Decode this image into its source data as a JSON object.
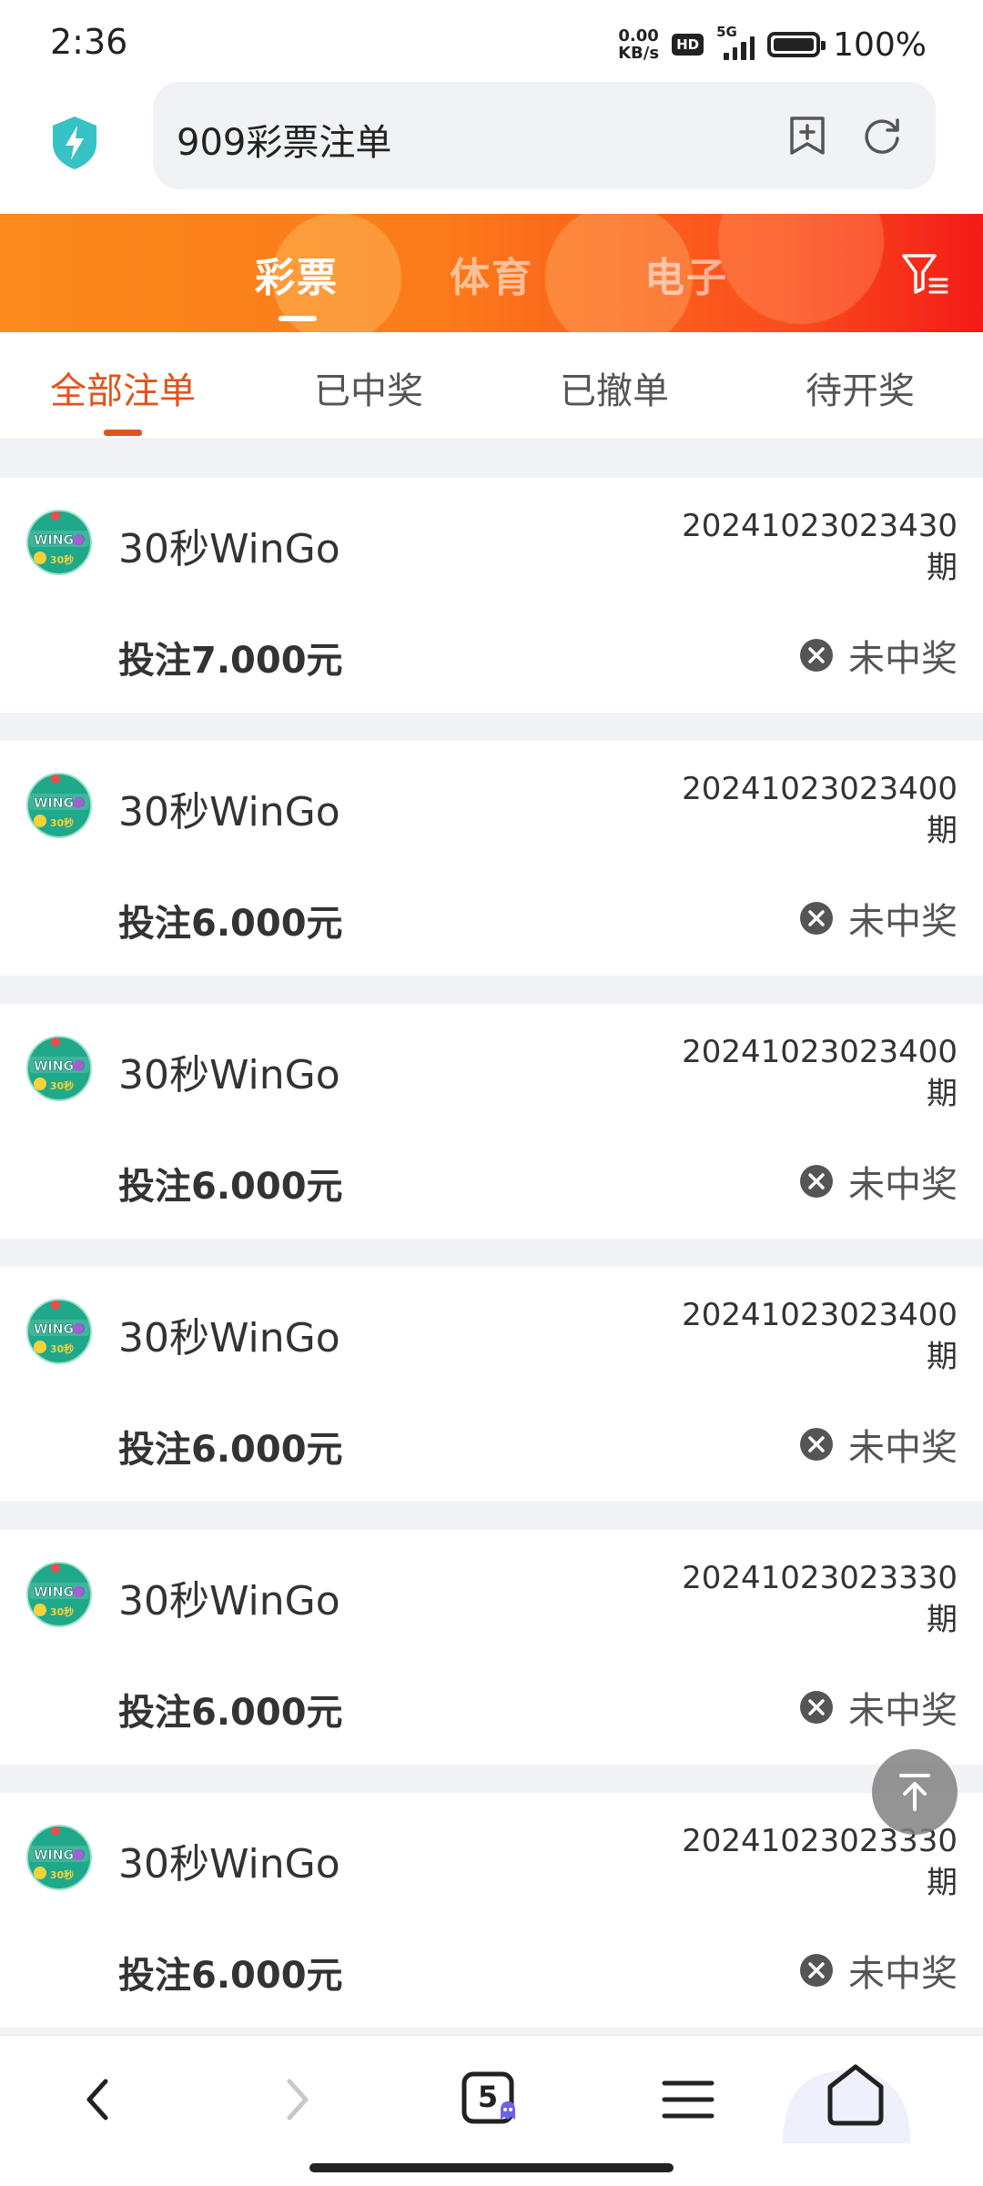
{
  "status_bar": {
    "time": "2:36",
    "net_speed_value": "0.00",
    "net_speed_unit": "KB/s",
    "hd": "HD",
    "network": "5G",
    "battery": "100%"
  },
  "address_bar": {
    "url_text": "909彩票注单"
  },
  "category_tabs": [
    {
      "label": "彩票",
      "active": true
    },
    {
      "label": "体育",
      "active": false
    },
    {
      "label": "电子",
      "active": false
    }
  ],
  "sub_tabs": [
    {
      "label": "全部注单",
      "active": true
    },
    {
      "label": "已中奖",
      "active": false
    },
    {
      "label": "已撤单",
      "active": false
    },
    {
      "label": "待开奖",
      "active": false
    }
  ],
  "bets": [
    {
      "game": "30秒WinGo",
      "issue": "20241023023430",
      "issue_suffix": "期",
      "amount": "投注7.000元",
      "status": "未中奖"
    },
    {
      "game": "30秒WinGo",
      "issue": "20241023023400",
      "issue_suffix": "期",
      "amount": "投注6.000元",
      "status": "未中奖"
    },
    {
      "game": "30秒WinGo",
      "issue": "20241023023400",
      "issue_suffix": "期",
      "amount": "投注6.000元",
      "status": "未中奖"
    },
    {
      "game": "30秒WinGo",
      "issue": "20241023023400",
      "issue_suffix": "期",
      "amount": "投注6.000元",
      "status": "未中奖"
    },
    {
      "game": "30秒WinGo",
      "issue": "20241023023330",
      "issue_suffix": "期",
      "amount": "投注6.000元",
      "status": "未中奖"
    },
    {
      "game": "30秒WinGo",
      "issue": "20241023023330",
      "issue_suffix": "期",
      "amount": "投注6.000元",
      "status": "未中奖"
    }
  ],
  "logo_text": {
    "line1": "WINGO",
    "line2": "30秒"
  },
  "bottom_nav": {
    "tab_count": "5"
  },
  "colors": {
    "accent": "#e0541b",
    "header_gradient_start": "#fb8a1c",
    "header_gradient_end": "#f31b17",
    "logo_green": "#1fa88a"
  }
}
